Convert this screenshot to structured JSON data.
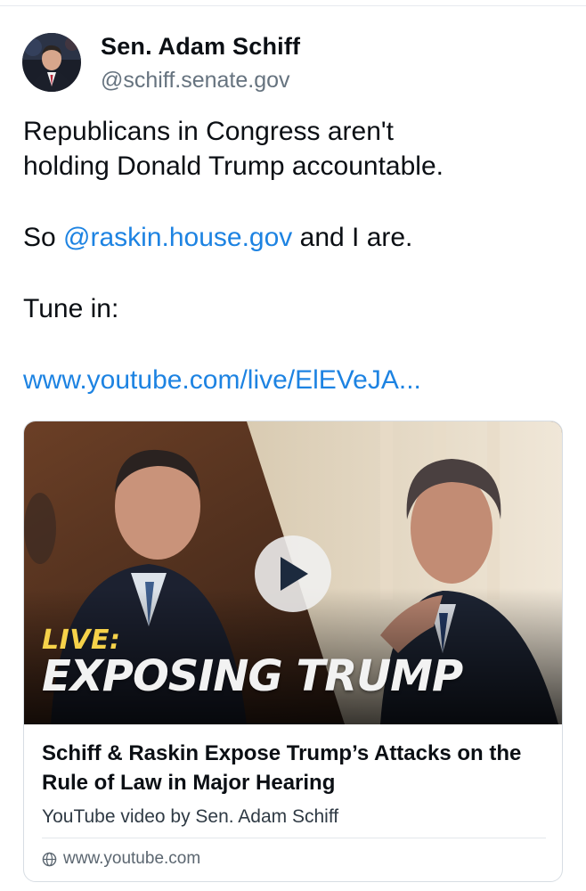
{
  "author": {
    "display_name": "Sen. Adam Schiff",
    "handle": "@schiff.senate.gov"
  },
  "post": {
    "line1": "Republicans in Congress aren't",
    "line2": "holding Donald Trump accountable.",
    "line3_prefix": "So ",
    "mention": "@raskin.house.gov",
    "line3_suffix": " and I are.",
    "line4": "Tune in:",
    "url_text": "www.youtube.com/live/ElEVeJA..."
  },
  "link_card": {
    "overlay_live": "LIVE:",
    "overlay_headline": "EXPOSING TRUMP",
    "title": "Schiff & Raskin Expose Trump’s Attacks on the Rule of Law in Major Hearing",
    "description": "YouTube video by Sen. Adam Schiff",
    "domain": "www.youtube.com"
  },
  "colors": {
    "link": "#1d83e2",
    "text": "#0b0f14",
    "muted": "#66737f",
    "overlay_live": "#f6d24a"
  }
}
